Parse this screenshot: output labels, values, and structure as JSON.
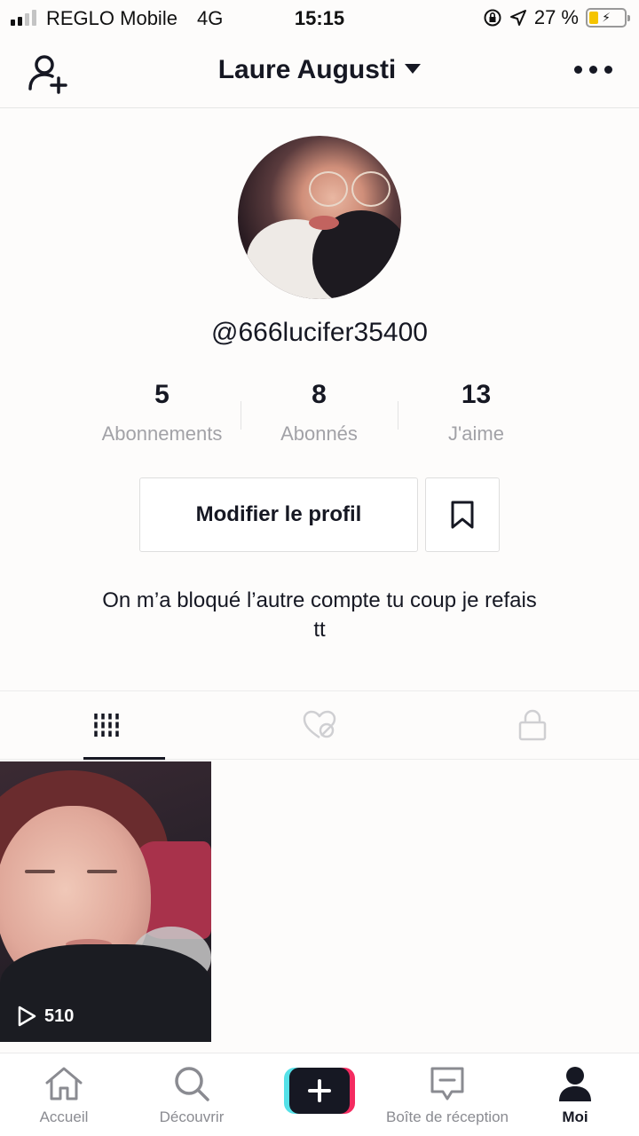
{
  "status_bar": {
    "carrier": "REGLO Mobile",
    "network": "4G",
    "time": "15:15",
    "battery_text": "27 %",
    "battery_level": 0.27,
    "signal_bars_active": 2
  },
  "header": {
    "title": "Laure Augusti"
  },
  "profile": {
    "handle": "@666lucifer35400",
    "stats": [
      {
        "value": "5",
        "label": "Abonnements"
      },
      {
        "value": "8",
        "label": "Abonnés"
      },
      {
        "value": "13",
        "label": "J'aime"
      }
    ],
    "edit_button": "Modifier le profil",
    "bio_line1": "On m’a bloqué l’autre compte tu coup je refais",
    "bio_line2": "tt"
  },
  "tabs": [
    {
      "icon": "grid-icon",
      "active": true
    },
    {
      "icon": "liked-hidden-icon",
      "active": false
    },
    {
      "icon": "lock-icon",
      "active": false
    }
  ],
  "videos": [
    {
      "views": "510"
    }
  ],
  "bottom_nav": {
    "home": "Accueil",
    "discover": "Découvrir",
    "create": "+",
    "inbox": "Boîte de réception",
    "me": "Moi"
  },
  "colors": {
    "text": "#161823",
    "muted": "#a2a2a7",
    "accent_pink": "#f42b60",
    "accent_cyan": "#55e1e8",
    "battery": "#f5c400"
  }
}
